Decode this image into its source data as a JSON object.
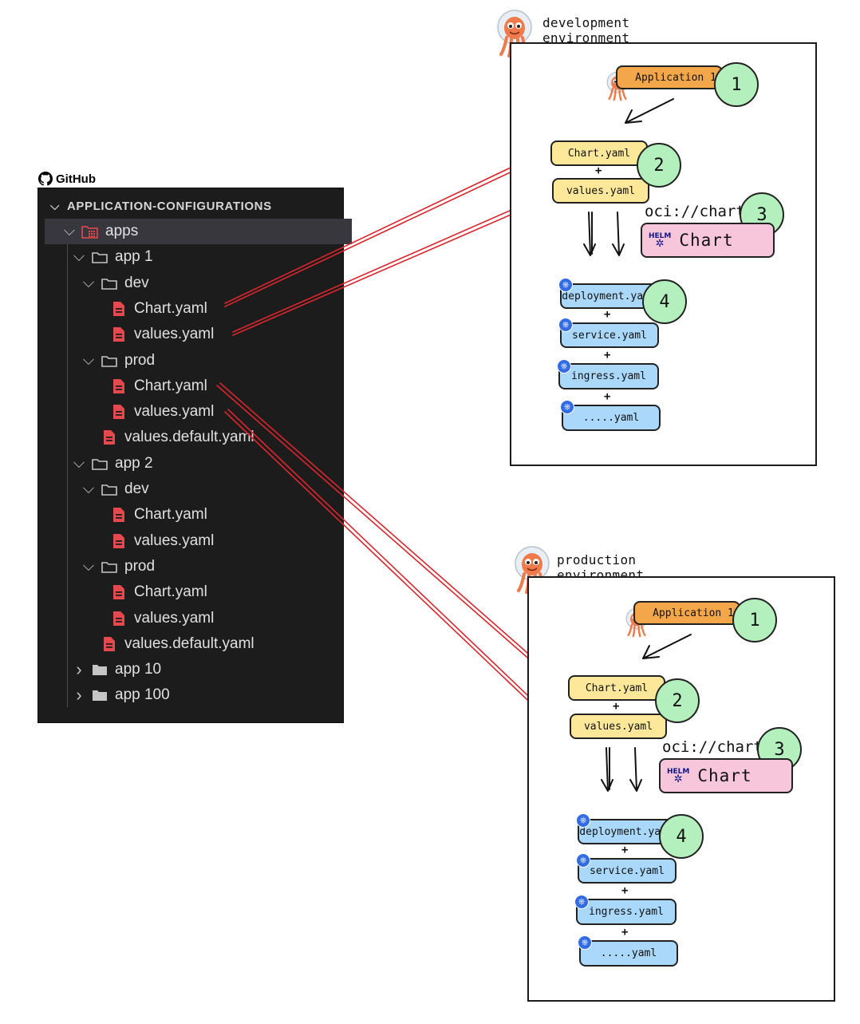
{
  "github": {
    "brand": "GitHub",
    "section_title": "APPLICATION-CONFIGURATIONS",
    "tree": [
      {
        "label": "apps",
        "type": "folder-special",
        "expanded": true,
        "depth": 1,
        "selected": true
      },
      {
        "label": "app 1",
        "type": "folder",
        "expanded": true,
        "depth": 2
      },
      {
        "label": "dev",
        "type": "folder",
        "expanded": true,
        "depth": 3
      },
      {
        "label": "Chart.yaml",
        "type": "file",
        "depth": 4
      },
      {
        "label": "values.yaml",
        "type": "file",
        "depth": 4
      },
      {
        "label": "prod",
        "type": "folder",
        "expanded": true,
        "depth": 3
      },
      {
        "label": "Chart.yaml",
        "type": "file",
        "depth": 4
      },
      {
        "label": "values.yaml",
        "type": "file",
        "depth": 4
      },
      {
        "label": "values.default.yaml",
        "type": "file",
        "depth": 3
      },
      {
        "label": "app 2",
        "type": "folder",
        "expanded": true,
        "depth": 2
      },
      {
        "label": "dev",
        "type": "folder",
        "expanded": true,
        "depth": 3
      },
      {
        "label": "Chart.yaml",
        "type": "file",
        "depth": 4
      },
      {
        "label": "values.yaml",
        "type": "file",
        "depth": 4
      },
      {
        "label": "prod",
        "type": "folder",
        "expanded": true,
        "depth": 3
      },
      {
        "label": "Chart.yaml",
        "type": "file",
        "depth": 4
      },
      {
        "label": "values.yaml",
        "type": "file",
        "depth": 4
      },
      {
        "label": "values.default.yaml",
        "type": "file",
        "depth": 3
      },
      {
        "label": "app 10",
        "type": "folder",
        "expanded": false,
        "depth": 2
      },
      {
        "label": "app 100",
        "type": "folder",
        "expanded": false,
        "depth": 2
      }
    ]
  },
  "environments": [
    {
      "title": "development environment",
      "application": "Application 1",
      "chart_file": "Chart.yaml",
      "values_file": "values.yaml",
      "plus": "+",
      "oci": "oci://chart",
      "helm_chart_label": "Chart",
      "helm_logo_text": "HELM",
      "manifests": [
        "deployment.yaml",
        "service.yaml",
        "ingress.yaml",
        ".....yaml"
      ],
      "steps": [
        "1",
        "2",
        "3",
        "4"
      ]
    },
    {
      "title": "production environment",
      "application": "Application 1",
      "chart_file": "Chart.yaml",
      "values_file": "values.yaml",
      "plus": "+",
      "oci": "oci://chart",
      "helm_chart_label": "Chart",
      "helm_logo_text": "HELM",
      "manifests": [
        "deployment.yaml",
        "service.yaml",
        "ingress.yaml",
        ".....yaml"
      ],
      "steps": [
        "1",
        "2",
        "3",
        "4"
      ]
    }
  ],
  "colors": {
    "panel_bg": "#1c1c1d",
    "arrow": "#d9262c",
    "file_icon": "#e5484d",
    "application_fill": "#f4a74a",
    "source_fill": "#fde89a",
    "manifest_fill": "#a9d8fb",
    "helm_fill": "#f7c6da",
    "step_fill": "#b4f0bd"
  },
  "icons": {
    "brand": "github-icon",
    "folder": "folder-icon",
    "folder_special": "special-folder-icon",
    "file": "yaml-file-icon",
    "mascot": "argo-octopus-icon",
    "helm": "helm-wheel-icon",
    "k8s": "kubernetes-icon"
  }
}
